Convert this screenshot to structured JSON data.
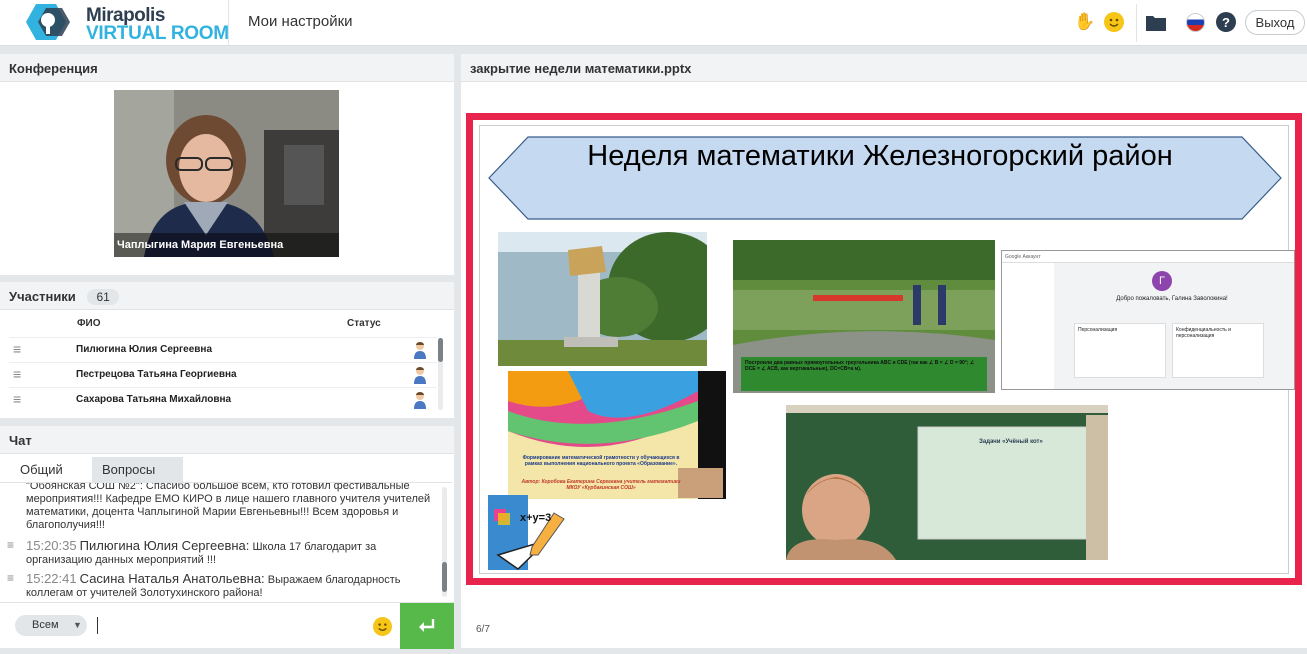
{
  "header": {
    "logo_line1": "Mirapolis",
    "logo_line2": "VIRTUAL ROOM",
    "my_settings": "Мои настройки",
    "logout": "Выход"
  },
  "conference": {
    "title": "Конференция",
    "speaker_name": "Чаплыгина Мария Евгеньевна"
  },
  "participants": {
    "title": "Участники",
    "count": "61",
    "col_name": "ФИО",
    "col_status": "Статус",
    "rows": [
      {
        "name": "Пилюгина  Юлия   Сергеевна"
      },
      {
        "name": "Пестрецова  Татьяна  Георгиевна"
      },
      {
        "name": "Сахарова Татьяна Михайловна"
      }
    ]
  },
  "chat": {
    "title": "Чат",
    "tab_general": "Общий",
    "tab_questions": "Вопросы",
    "messages": [
      {
        "time": "",
        "author": "",
        "text": "\"Обоянская СОШ №2\": Спасибо большое всем, кто готовил фестивальные мероприятия!!! Кафедре ЕМО КИРО в лице нашего главного учителя учителей математики, доцента Чаплыгиной Марии Евгеньевны!!! Всем здоровья и благополучия!!!"
      },
      {
        "time": "15:20:35",
        "author": "Пилюгина  Юлия   Сергеевна:",
        "text": "Школа  17 благодарит за организацию данных мероприятий !!!"
      },
      {
        "time": "15:22:41",
        "author": "Сасина  Наталья  Анатольевна:",
        "text": "Выражаем благодарность коллегам от учителей Золотухинского района!"
      }
    ],
    "recipient": "Всем"
  },
  "presentation": {
    "title": "закрытие недели математики.pptx",
    "slide_title": "Неделя математики Железногорский район",
    "page": "6/7",
    "pic_park_caption": "Построили два равных прямоугольных треугольника ABC и CDE (так как ∠ B = ∠ D = 90°; ∠ DCE = ∠ ACB, как вертикальные), DC=CB=a м).",
    "pic_poster_caption": "Формирование математической грамотности у обучающихся в рамках выполнения национального проекта «Образование».",
    "pic_poster_author": "Автор: Коробова Екатерина Сергеевна учитель математики МКОУ «Курбакинская СОШ»",
    "pic_google_greeting": "Добро пожаловать, Галина Заволокина!",
    "pic_google_avatar": "Г",
    "pic_google_app": "Google Аккаунт",
    "pic_google_card1": "Персонализация",
    "pic_google_card2": "Конфиденциальность и персонализация",
    "pic_board_title": "Задачи «Учёный кот»",
    "pic_formula": "x+y=3"
  },
  "colors": {
    "accent_blue": "#32b3df",
    "slide_border": "#e8234c",
    "send_green": "#57b94a"
  },
  "icons": [
    "hand-icon",
    "smile-icon",
    "folder-icon",
    "flag-ru-icon",
    "help-icon",
    "menu-icon",
    "user-status-icon",
    "send-icon"
  ]
}
